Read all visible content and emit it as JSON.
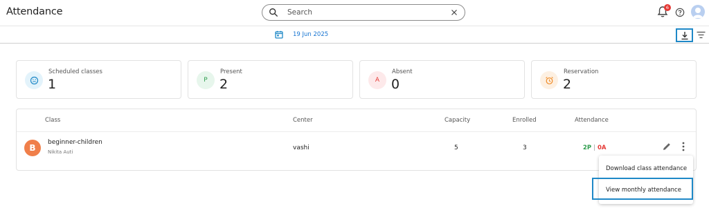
{
  "header": {
    "title": "Attendance",
    "search": {
      "placeholder": "Search",
      "value": ""
    },
    "notifications_count": "6",
    "icons": [
      "search-icon",
      "clear-icon",
      "bell-icon",
      "help-icon",
      "user-avatar"
    ]
  },
  "date_bar": {
    "date": "19 Jun 2025",
    "icons": [
      "calendar-icon",
      "download-icon",
      "filter-icon"
    ]
  },
  "stats": [
    {
      "label": "Scheduled classes",
      "value": "1",
      "icon": "school-icon",
      "bg": "#e3f3fb",
      "fg": "#1e88c7"
    },
    {
      "label": "Present",
      "value": "2",
      "icon": "P",
      "bg": "#e7f6ec",
      "fg": "#2e9d4d"
    },
    {
      "label": "Absent",
      "value": "0",
      "icon": "A",
      "bg": "#fde9ea",
      "fg": "#e53935"
    },
    {
      "label": "Reservation",
      "value": "2",
      "icon": "alarm-icon",
      "bg": "#fdf0e2",
      "fg": "#f08a24"
    }
  ],
  "table": {
    "headers": {
      "class": "Class",
      "center": "Center",
      "capacity": "Capacity",
      "enrolled": "Enrolled",
      "attendance": "Attendance"
    },
    "rows": [
      {
        "avatar": "B",
        "class_name": "beginner-children",
        "instructor": "Nikita Auti",
        "center": "vashi",
        "capacity": "5",
        "enrolled": "3",
        "present": "2P",
        "separator": "|",
        "absent": "0A"
      }
    ]
  },
  "menu": {
    "items": [
      {
        "label": "Download class attendance"
      },
      {
        "label": "View monthly attendance"
      }
    ]
  },
  "colors": {
    "accent": "#1e88c7",
    "present": "#2e9d4d",
    "absent": "#e53935",
    "avatar": "#f07f4a"
  }
}
